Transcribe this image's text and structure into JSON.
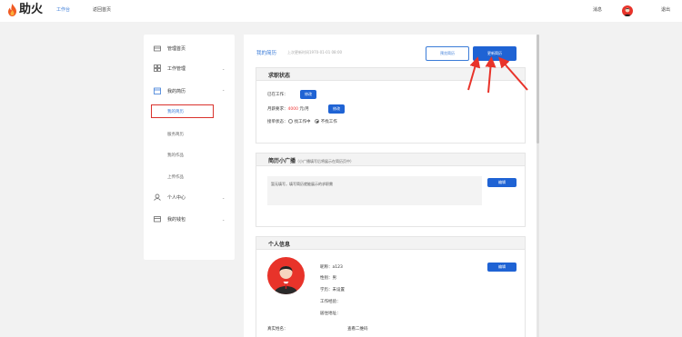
{
  "topbar": {
    "brand": "助火",
    "nav_workbench": "工作台",
    "nav_home": "返回首页",
    "nav_message": "消息",
    "nav_logout": "退出"
  },
  "sidebar": {
    "items": [
      {
        "label": "管理首页",
        "icon": "home-icon"
      },
      {
        "label": "工作管理",
        "icon": "grid-icon"
      },
      {
        "label": "我的简历",
        "icon": "calendar-icon"
      },
      {
        "label": "个人中心",
        "icon": "person-icon"
      },
      {
        "label": "我的钱包",
        "icon": "wallet-icon"
      }
    ],
    "sub_items": [
      "我的简历",
      "服务简历",
      "我的作品",
      "上传作品"
    ]
  },
  "main": {
    "title": "我的简历",
    "update_time": "上次更新时间1970-01-01 08:00",
    "btn_preview": "预览简历",
    "btn_update": "更新简历"
  },
  "job_status": {
    "title": "求职状态",
    "employed_label": "已在工作：",
    "btn_modify_1": "修改",
    "salary_label": "月薪要求：",
    "salary_value": "4000",
    "salary_unit": " 元/月",
    "btn_modify_2": "修改",
    "accept_label": "接单状态：",
    "opt_free": "找工作中",
    "opt_busy": "不找工作",
    "selected": "不找工作"
  },
  "broadcast": {
    "title": "简历小广播",
    "hint": "（小广播填写后将展示在简历页中）",
    "placeholder": "暂无填写，填写简历就能展示的求职需",
    "btn_edit": "编辑"
  },
  "personal": {
    "title": "个人信息",
    "nickname": "昵称：a123",
    "gender": "性别：男",
    "education": "学历：未设置",
    "experience": "工作经验：",
    "address": "居住地址：",
    "realname_label": "真实姓名：",
    "realname_value": "查看二维码",
    "btn_edit": "编辑"
  },
  "colors": {
    "accent": "#1f63d4",
    "link": "#3b7cd8",
    "highlight": "#d9322c"
  }
}
